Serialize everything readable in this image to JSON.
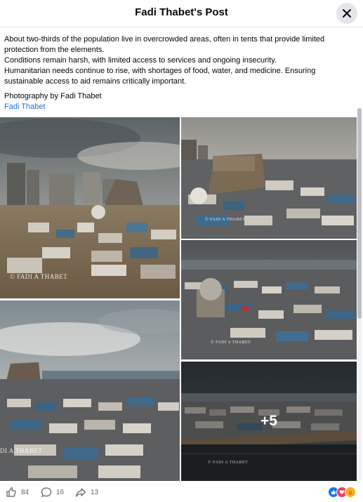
{
  "header": {
    "title": "Fadi Thabet's Post"
  },
  "post": {
    "paragraphs": [
      "About two-thirds of the population live in overcrowded areas, often in tents that provide limited protection from the elements.",
      "Conditions remain harsh, with limited access to services and ongoing insecurity.",
      "Humanitarian needs continue to rise, with shortages of food, water, and medicine. Ensuring sustainable access to aid remains critically important."
    ],
    "credit": "Photography by Fadi Thabet",
    "author": "Fadi Thabet"
  },
  "photos": {
    "watermark": "© FADI A THABET",
    "watermark_cut": "DI A THABET",
    "more_count": "+5"
  },
  "footer": {
    "likes": "84",
    "comments": "16",
    "shares": "13",
    "reaction_icons": [
      "like-icon",
      "love-icon",
      "care-icon"
    ]
  },
  "colors": {
    "link": "#216fdb",
    "like": "#1877f2",
    "love": "#f33e58",
    "care": "#f7b125"
  }
}
